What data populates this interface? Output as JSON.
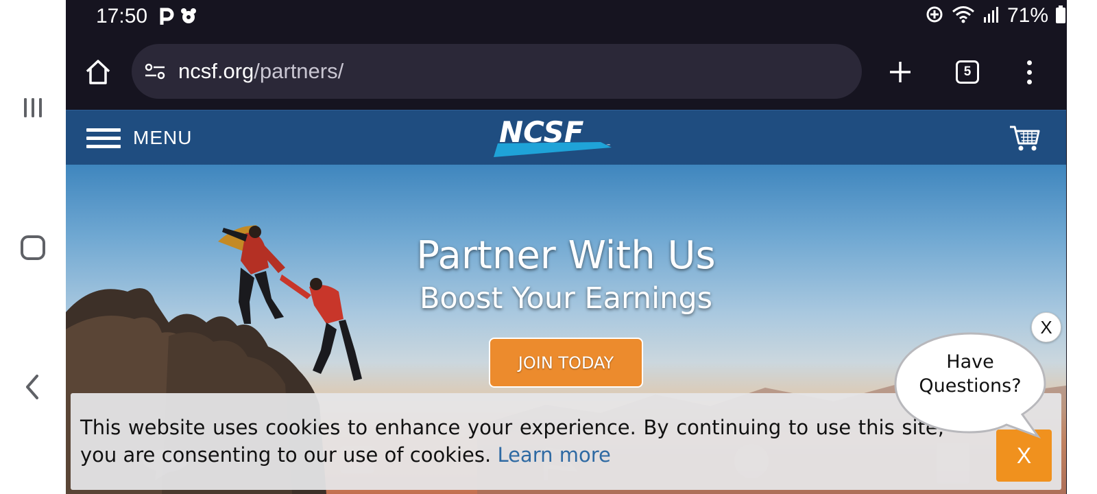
{
  "status_bar": {
    "time": "17:50",
    "battery": "71%",
    "icons": [
      "parking-notification-icon",
      "settings-notification-icon",
      "location-icon",
      "wifi-icon",
      "signal-icon",
      "battery-icon"
    ]
  },
  "browser": {
    "url_host": "ncsf.org",
    "url_path": "/partners/",
    "tab_count": "5",
    "icons": [
      "home-icon",
      "site-info-icon",
      "new-tab-icon",
      "tabs-icon",
      "more-options-icon"
    ]
  },
  "android_nav": {
    "icons": [
      "recent-apps-icon",
      "home-icon",
      "back-icon"
    ]
  },
  "site_header": {
    "menu_label": "MENU",
    "logo_text": "NCSF",
    "logo_mark": "™",
    "icons": [
      "hamburger-icon",
      "cart-icon"
    ]
  },
  "hero": {
    "title": "Partner With Us",
    "subtitle": "Boost Your Earnings",
    "cta_label": "JOIN TODAY"
  },
  "cookie_banner": {
    "text": "This website uses cookies to enhance your experience. By continuing to use this site, you are consenting to our use of cookies. ",
    "learn_more": "Learn more",
    "close_label": "X"
  },
  "chat_widget": {
    "line1": "Have",
    "line2": "Questions?",
    "close_label": "X"
  },
  "colors": {
    "status_bar_bg": "#161420",
    "url_bar_bg": "#2b2838",
    "header_blue": "#1f4d80",
    "cta_orange": "#ec8b2d",
    "cookie_close_orange": "#f0911e",
    "link_blue": "#2f6aa3",
    "logo_cyan": "#1fa3d8"
  }
}
